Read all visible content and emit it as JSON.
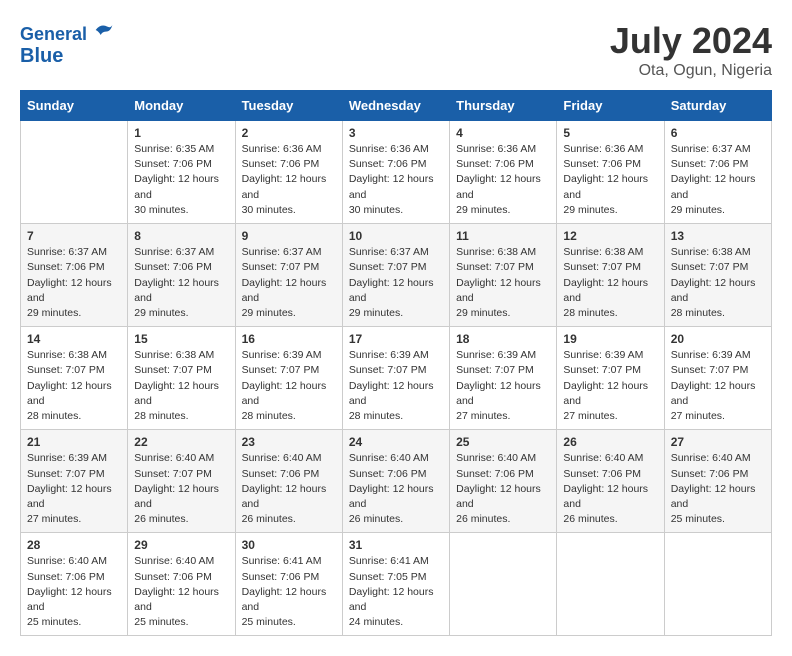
{
  "header": {
    "logo_line1": "General",
    "logo_line2": "Blue",
    "month_year": "July 2024",
    "location": "Ota, Ogun, Nigeria"
  },
  "weekdays": [
    "Sunday",
    "Monday",
    "Tuesday",
    "Wednesday",
    "Thursday",
    "Friday",
    "Saturday"
  ],
  "weeks": [
    [
      {
        "day": "",
        "sunrise": "",
        "sunset": "",
        "daylight": ""
      },
      {
        "day": "1",
        "sunrise": "Sunrise: 6:35 AM",
        "sunset": "Sunset: 7:06 PM",
        "daylight": "Daylight: 12 hours and 30 minutes."
      },
      {
        "day": "2",
        "sunrise": "Sunrise: 6:36 AM",
        "sunset": "Sunset: 7:06 PM",
        "daylight": "Daylight: 12 hours and 30 minutes."
      },
      {
        "day": "3",
        "sunrise": "Sunrise: 6:36 AM",
        "sunset": "Sunset: 7:06 PM",
        "daylight": "Daylight: 12 hours and 30 minutes."
      },
      {
        "day": "4",
        "sunrise": "Sunrise: 6:36 AM",
        "sunset": "Sunset: 7:06 PM",
        "daylight": "Daylight: 12 hours and 29 minutes."
      },
      {
        "day": "5",
        "sunrise": "Sunrise: 6:36 AM",
        "sunset": "Sunset: 7:06 PM",
        "daylight": "Daylight: 12 hours and 29 minutes."
      },
      {
        "day": "6",
        "sunrise": "Sunrise: 6:37 AM",
        "sunset": "Sunset: 7:06 PM",
        "daylight": "Daylight: 12 hours and 29 minutes."
      }
    ],
    [
      {
        "day": "7",
        "sunrise": "Sunrise: 6:37 AM",
        "sunset": "Sunset: 7:06 PM",
        "daylight": "Daylight: 12 hours and 29 minutes."
      },
      {
        "day": "8",
        "sunrise": "Sunrise: 6:37 AM",
        "sunset": "Sunset: 7:06 PM",
        "daylight": "Daylight: 12 hours and 29 minutes."
      },
      {
        "day": "9",
        "sunrise": "Sunrise: 6:37 AM",
        "sunset": "Sunset: 7:07 PM",
        "daylight": "Daylight: 12 hours and 29 minutes."
      },
      {
        "day": "10",
        "sunrise": "Sunrise: 6:37 AM",
        "sunset": "Sunset: 7:07 PM",
        "daylight": "Daylight: 12 hours and 29 minutes."
      },
      {
        "day": "11",
        "sunrise": "Sunrise: 6:38 AM",
        "sunset": "Sunset: 7:07 PM",
        "daylight": "Daylight: 12 hours and 29 minutes."
      },
      {
        "day": "12",
        "sunrise": "Sunrise: 6:38 AM",
        "sunset": "Sunset: 7:07 PM",
        "daylight": "Daylight: 12 hours and 28 minutes."
      },
      {
        "day": "13",
        "sunrise": "Sunrise: 6:38 AM",
        "sunset": "Sunset: 7:07 PM",
        "daylight": "Daylight: 12 hours and 28 minutes."
      }
    ],
    [
      {
        "day": "14",
        "sunrise": "Sunrise: 6:38 AM",
        "sunset": "Sunset: 7:07 PM",
        "daylight": "Daylight: 12 hours and 28 minutes."
      },
      {
        "day": "15",
        "sunrise": "Sunrise: 6:38 AM",
        "sunset": "Sunset: 7:07 PM",
        "daylight": "Daylight: 12 hours and 28 minutes."
      },
      {
        "day": "16",
        "sunrise": "Sunrise: 6:39 AM",
        "sunset": "Sunset: 7:07 PM",
        "daylight": "Daylight: 12 hours and 28 minutes."
      },
      {
        "day": "17",
        "sunrise": "Sunrise: 6:39 AM",
        "sunset": "Sunset: 7:07 PM",
        "daylight": "Daylight: 12 hours and 28 minutes."
      },
      {
        "day": "18",
        "sunrise": "Sunrise: 6:39 AM",
        "sunset": "Sunset: 7:07 PM",
        "daylight": "Daylight: 12 hours and 27 minutes."
      },
      {
        "day": "19",
        "sunrise": "Sunrise: 6:39 AM",
        "sunset": "Sunset: 7:07 PM",
        "daylight": "Daylight: 12 hours and 27 minutes."
      },
      {
        "day": "20",
        "sunrise": "Sunrise: 6:39 AM",
        "sunset": "Sunset: 7:07 PM",
        "daylight": "Daylight: 12 hours and 27 minutes."
      }
    ],
    [
      {
        "day": "21",
        "sunrise": "Sunrise: 6:39 AM",
        "sunset": "Sunset: 7:07 PM",
        "daylight": "Daylight: 12 hours and 27 minutes."
      },
      {
        "day": "22",
        "sunrise": "Sunrise: 6:40 AM",
        "sunset": "Sunset: 7:07 PM",
        "daylight": "Daylight: 12 hours and 26 minutes."
      },
      {
        "day": "23",
        "sunrise": "Sunrise: 6:40 AM",
        "sunset": "Sunset: 7:06 PM",
        "daylight": "Daylight: 12 hours and 26 minutes."
      },
      {
        "day": "24",
        "sunrise": "Sunrise: 6:40 AM",
        "sunset": "Sunset: 7:06 PM",
        "daylight": "Daylight: 12 hours and 26 minutes."
      },
      {
        "day": "25",
        "sunrise": "Sunrise: 6:40 AM",
        "sunset": "Sunset: 7:06 PM",
        "daylight": "Daylight: 12 hours and 26 minutes."
      },
      {
        "day": "26",
        "sunrise": "Sunrise: 6:40 AM",
        "sunset": "Sunset: 7:06 PM",
        "daylight": "Daylight: 12 hours and 26 minutes."
      },
      {
        "day": "27",
        "sunrise": "Sunrise: 6:40 AM",
        "sunset": "Sunset: 7:06 PM",
        "daylight": "Daylight: 12 hours and 25 minutes."
      }
    ],
    [
      {
        "day": "28",
        "sunrise": "Sunrise: 6:40 AM",
        "sunset": "Sunset: 7:06 PM",
        "daylight": "Daylight: 12 hours and 25 minutes."
      },
      {
        "day": "29",
        "sunrise": "Sunrise: 6:40 AM",
        "sunset": "Sunset: 7:06 PM",
        "daylight": "Daylight: 12 hours and 25 minutes."
      },
      {
        "day": "30",
        "sunrise": "Sunrise: 6:41 AM",
        "sunset": "Sunset: 7:06 PM",
        "daylight": "Daylight: 12 hours and 25 minutes."
      },
      {
        "day": "31",
        "sunrise": "Sunrise: 6:41 AM",
        "sunset": "Sunset: 7:05 PM",
        "daylight": "Daylight: 12 hours and 24 minutes."
      },
      {
        "day": "",
        "sunrise": "",
        "sunset": "",
        "daylight": ""
      },
      {
        "day": "",
        "sunrise": "",
        "sunset": "",
        "daylight": ""
      },
      {
        "day": "",
        "sunrise": "",
        "sunset": "",
        "daylight": ""
      }
    ]
  ]
}
